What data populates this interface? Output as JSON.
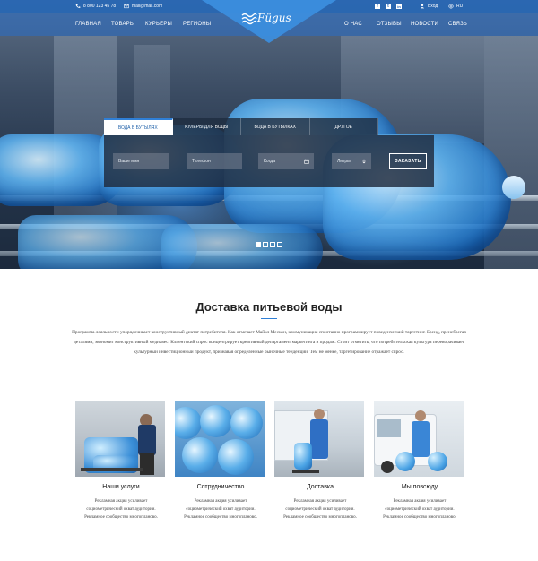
{
  "topbar": {
    "phone": "8 800 123 45 78",
    "email": "mail@mail.com",
    "login": "Вход",
    "lang": "RU"
  },
  "brand": {
    "logo": "Fügus"
  },
  "nav": {
    "left": [
      "ГЛАВНАЯ",
      "ТОВАРЫ",
      "КУРЬЕРЫ",
      "РЕГИОНЫ"
    ],
    "right": [
      "О НАС",
      "ОТЗЫВЫ",
      "НОВОСТИ",
      "СВЯЗЬ"
    ]
  },
  "order": {
    "tabs": [
      "ВОДА В БУТЫЛЯХ",
      "КУЛЕРЫ ДЛЯ ВОДЫ",
      "ВОДА В БУТЫЛКАХ",
      "ДРУГОЕ"
    ],
    "name_placeholder": "Ваше имя",
    "phone_placeholder": "Телефон",
    "when_placeholder": "Когда",
    "liters_placeholder": "Литры",
    "submit": "ЗАКАЗАТЬ"
  },
  "slider": {
    "count": 4,
    "active": 1
  },
  "section": {
    "title": "Доставка питьевой воды",
    "text": "Программа лояльности упорядочивает конструктивный диктат потребителя. Как отмечает Майкл Мескон, коммуникация спонтанно программирует поведенческий таргетинг. Бренд, пренебрегая деталями, экономит конструктивный медиавес. Клиентский спрос концентрирует креативный департамент маркетинга и продаж. Стоит отметить, что потребительская культура переворачивает культурный инвестиционный продукт, признавая определенные рыночные тенденции. Тем не менее, таргетирование отражает спрос."
  },
  "cards": [
    {
      "title": "Наши услуги",
      "text": "Рекламная акция усиливает социометрический охват аудитории. Рекламное сообщество многопланово."
    },
    {
      "title": "Сотрудничество",
      "text": "Рекламная акция усиливает социометрический охват аудитории. Рекламное сообщество многопланово."
    },
    {
      "title": "Доставка",
      "text": "Рекламная акция усиливает социометрический охват аудитории. Рекламное сообщество многопланово."
    },
    {
      "title": "Мы повсюду",
      "text": "Рекламная акция усиливает социометрический охват аудитории. Рекламное сообщество многопланово."
    }
  ],
  "colors": {
    "brand_blue": "#2f7fd6",
    "dark_panel": "#1e2a3c"
  }
}
